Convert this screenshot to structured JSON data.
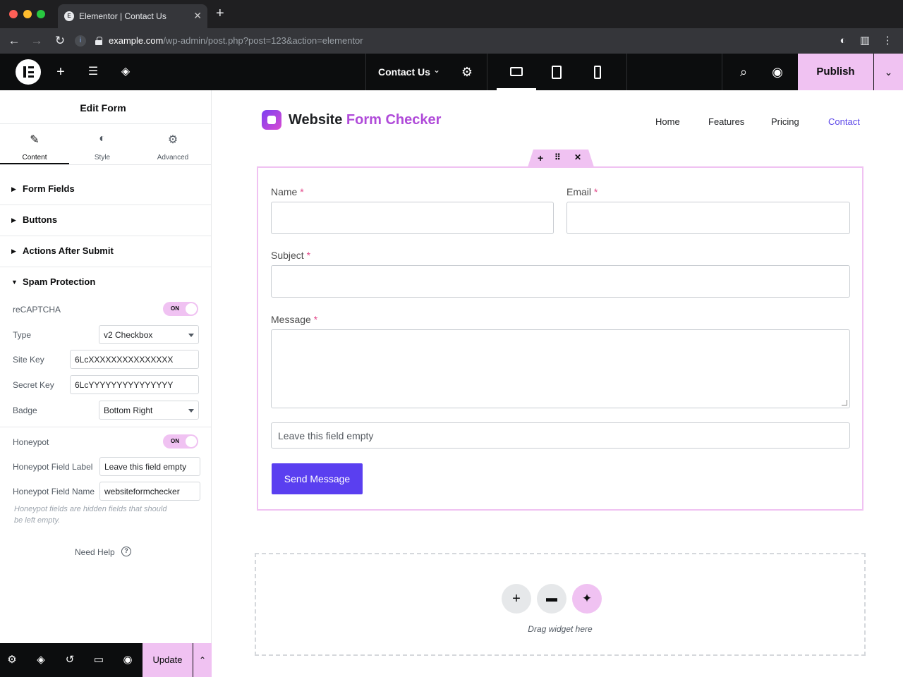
{
  "browser": {
    "tab_title": "Elementor | Contact Us",
    "tab_favicon": "E",
    "url_host": "example.com",
    "url_path": "/wp-admin/post.php?post=123&action=elementor"
  },
  "topbar": {
    "document_title": "Contact Us",
    "publish_label": "Publish",
    "active_device": "desktop",
    "accent_color": "#f0c2f2"
  },
  "panel": {
    "title": "Edit Form",
    "tabs": [
      {
        "label": "Content",
        "icon": "pencil-icon",
        "active": true
      },
      {
        "label": "Style",
        "icon": "half-circle-icon",
        "active": false
      },
      {
        "label": "Advanced",
        "icon": "gear-icon",
        "active": false
      }
    ],
    "sections": [
      {
        "label": "Form Fields",
        "expanded": false
      },
      {
        "label": "Buttons",
        "expanded": false
      },
      {
        "label": "Actions After Submit",
        "expanded": false
      },
      {
        "label": "Spam Protection",
        "expanded": true
      }
    ],
    "spam": {
      "recaptcha_label": "reCAPTCHA",
      "recaptcha_toggle": "ON",
      "type_label": "Type",
      "type_value": "v2 Checkbox",
      "site_key_label": "Site Key",
      "site_key_value": "6LcXXXXXXXXXXXXXXX",
      "secret_key_label": "Secret Key",
      "secret_key_value": "6LcYYYYYYYYYYYYYYY",
      "badge_label": "Badge",
      "badge_value": "Bottom Right",
      "honeypot_label": "Honeypot",
      "honeypot_toggle": "ON",
      "hp_field_label_label": "Honeypot Field Label",
      "hp_field_label_value": "Leave this field empty",
      "hp_field_name_label": "Honeypot Field Name",
      "hp_field_name_value": "websiteformchecker",
      "hint": "Honeypot fields are hidden fields that should be left empty."
    },
    "need_help": "Need Help",
    "update_label": "Update"
  },
  "site": {
    "name_part1": "Website",
    "name_part2": "Form Checker",
    "nav": [
      "Home",
      "Features",
      "Pricing",
      "Contact"
    ],
    "active_nav": "Contact"
  },
  "form": {
    "name_label": "Name",
    "email_label": "Email",
    "subject_label": "Subject",
    "message_label": "Message",
    "required_mark": "*",
    "honeypot_text": "Leave this field empty",
    "submit_label": "Send Message",
    "button_color": "#5a3ff0"
  },
  "dropzone": {
    "text": "Drag widget here"
  }
}
